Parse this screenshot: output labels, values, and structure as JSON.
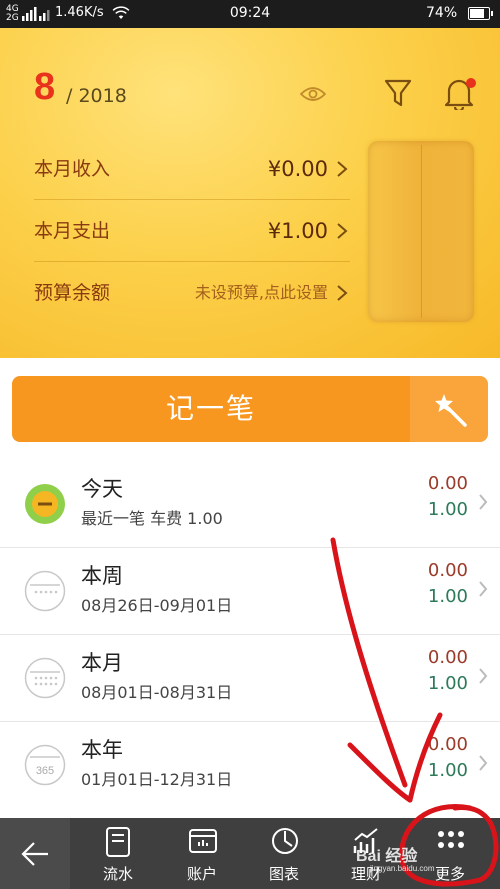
{
  "status_bar": {
    "signal_1": "4G",
    "signal_2": "2G",
    "speed": "1.46K/s",
    "time": "09:24",
    "battery": "74%"
  },
  "header": {
    "month": "8",
    "year_text": "/ 2018",
    "icons": [
      "eye-icon",
      "filter-icon",
      "bell-icon"
    ],
    "notification_dot_color": "#e8321b",
    "income_label": "本月收入",
    "income_value": "¥0.00",
    "expense_label": "本月支出",
    "expense_value": "¥1.00",
    "budget_label": "预算余额",
    "budget_value": "未设预算,点此设置"
  },
  "record_button": {
    "label": "记一笔",
    "color": "#f8971f"
  },
  "periods": [
    {
      "title": "今天",
      "subtitle": "最近一笔 车费 1.00",
      "income": "0.00",
      "expense": "1.00"
    },
    {
      "title": "本周",
      "subtitle": "08月26日-09月01日",
      "income": "0.00",
      "expense": "1.00"
    },
    {
      "title": "本月",
      "subtitle": "08月01日-08月31日",
      "income": "0.00",
      "expense": "1.00"
    },
    {
      "title": "本年",
      "subtitle": "01月01日-12月31日",
      "income": "0.00",
      "expense": "1.00",
      "icon_text": "365"
    }
  ],
  "bottom_nav": {
    "items": [
      {
        "label": "流水",
        "icon": "ledger-icon"
      },
      {
        "label": "账户",
        "icon": "wallet-icon"
      },
      {
        "label": "图表",
        "icon": "chart-icon"
      },
      {
        "label": "理财",
        "icon": "trend-icon"
      },
      {
        "label": "更多",
        "icon": "more-icon"
      }
    ]
  },
  "watermark": {
    "text": "Bai 经验",
    "sub": "jingyan.baidu.com"
  },
  "colors": {
    "income_text": "#9b3b2a",
    "expense_text": "#2d7a5a",
    "annotation_red": "#d8141a"
  }
}
